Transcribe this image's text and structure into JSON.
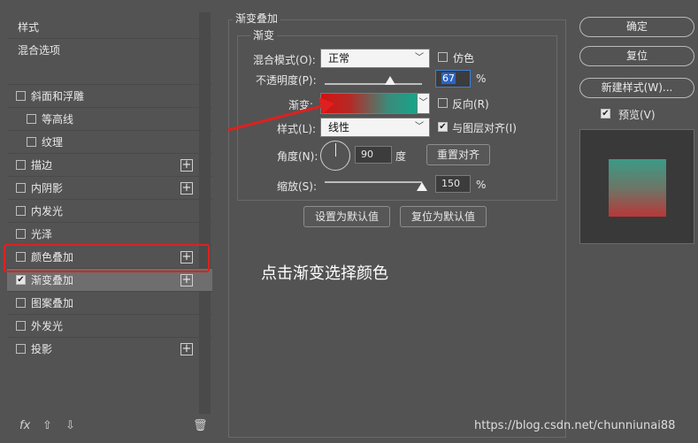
{
  "left_panel": {
    "header": "样式",
    "blend_options": "混合选项",
    "items": [
      {
        "label": "斜面和浮雕",
        "checked": false,
        "indent": false,
        "plus": false
      },
      {
        "label": "等高线",
        "checked": false,
        "indent": true,
        "plus": false
      },
      {
        "label": "纹理",
        "checked": false,
        "indent": true,
        "plus": false
      },
      {
        "label": "描边",
        "checked": false,
        "indent": false,
        "plus": true
      },
      {
        "label": "内阴影",
        "checked": false,
        "indent": false,
        "plus": true
      },
      {
        "label": "内发光",
        "checked": false,
        "indent": false,
        "plus": false
      },
      {
        "label": "光泽",
        "checked": false,
        "indent": false,
        "plus": false
      },
      {
        "label": "颜色叠加",
        "checked": false,
        "indent": false,
        "plus": true
      },
      {
        "label": "渐变叠加",
        "checked": true,
        "indent": false,
        "plus": true,
        "selected": true
      },
      {
        "label": "图案叠加",
        "checked": false,
        "indent": false,
        "plus": false
      },
      {
        "label": "外发光",
        "checked": false,
        "indent": false,
        "plus": false
      },
      {
        "label": "投影",
        "checked": false,
        "indent": false,
        "plus": true
      }
    ],
    "bottom_icons": [
      "fx-icon",
      "arrow-up-icon",
      "arrow-down-icon",
      "trash-icon"
    ],
    "fx_label": "fx"
  },
  "gradient_overlay": {
    "group_title": "渐变叠加",
    "sub_group_title": "渐变",
    "blend_mode_label": "混合模式(O):",
    "blend_mode_value": "正常",
    "dither_label": "仿色",
    "dither_checked": false,
    "opacity_label": "不透明度(P):",
    "opacity_value": "67",
    "opacity_unit": "%",
    "opacity_fraction": 0.67,
    "gradient_label": "渐变:",
    "gradient_colors": [
      "#d21212",
      "#16a58a"
    ],
    "reverse_label": "反向(R)",
    "reverse_checked": false,
    "style_label": "样式(L):",
    "style_value": "线性",
    "align_label": "与图层对齐(I)",
    "align_checked": true,
    "angle_label": "角度(N):",
    "angle_value": "90",
    "angle_unit": "度",
    "reset_align_label": "重置对齐",
    "scale_label": "缩放(S):",
    "scale_value": "150",
    "scale_unit": "%",
    "scale_fraction": 1.0,
    "set_default_label": "设置为默认值",
    "reset_default_label": "复位为默认值"
  },
  "right_panel": {
    "ok_label": "确定",
    "reset_label": "复位",
    "new_style_label": "新建样式(W)...",
    "preview_label": "预览(V)",
    "preview_checked": true
  },
  "annotation": "点击渐变选择颜色",
  "watermark": "https://blog.csdn.net/chunniunai88",
  "colors": {
    "highlight_box": "#e0201f",
    "arrow": "#e0201f",
    "background": "#535353"
  }
}
